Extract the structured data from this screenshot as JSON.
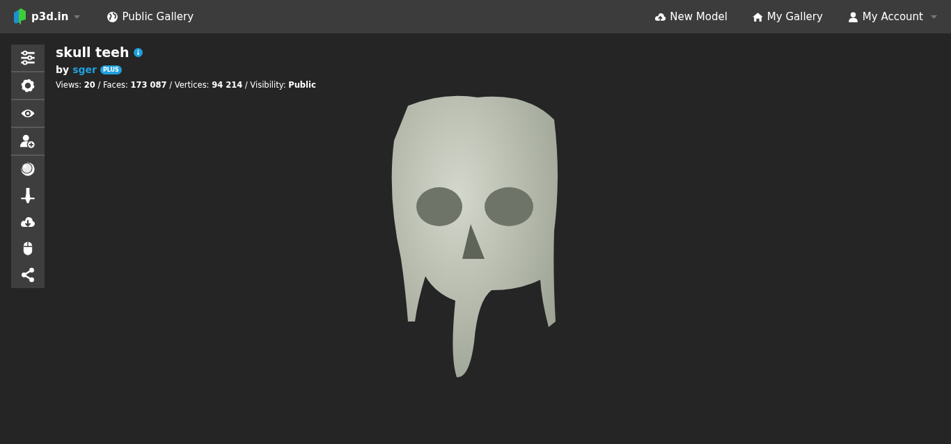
{
  "navbar": {
    "brand": "p3d.in",
    "left_links": [
      {
        "kind": "globe",
        "label": "Public Gallery"
      }
    ],
    "right_links": [
      {
        "kind": "cloud-upload",
        "label": "New Model",
        "dropdown": false
      },
      {
        "kind": "home",
        "label": "My Gallery",
        "dropdown": false
      },
      {
        "kind": "user",
        "label": "My Account",
        "dropdown": true
      }
    ]
  },
  "toolbar": {
    "groups": [
      {
        "tools": [
          {
            "kind": "sliders"
          }
        ]
      },
      {
        "tools": [
          {
            "kind": "gear"
          }
        ]
      },
      {
        "tools": [
          {
            "kind": "eye"
          }
        ]
      },
      {
        "tools": [
          {
            "kind": "user-add"
          }
        ]
      },
      {
        "tools": [
          {
            "kind": "sphere"
          },
          {
            "kind": "pin"
          },
          {
            "kind": "cloud-download"
          },
          {
            "kind": "mouse"
          },
          {
            "kind": "share"
          }
        ]
      }
    ]
  },
  "model": {
    "title": "skull teeh",
    "by": "by",
    "author": "sger",
    "badge": "PLUS",
    "stats": "Views: **20** / Faces: **173 087** / Vertices: **94 214** / Visibility: **Public**"
  }
}
